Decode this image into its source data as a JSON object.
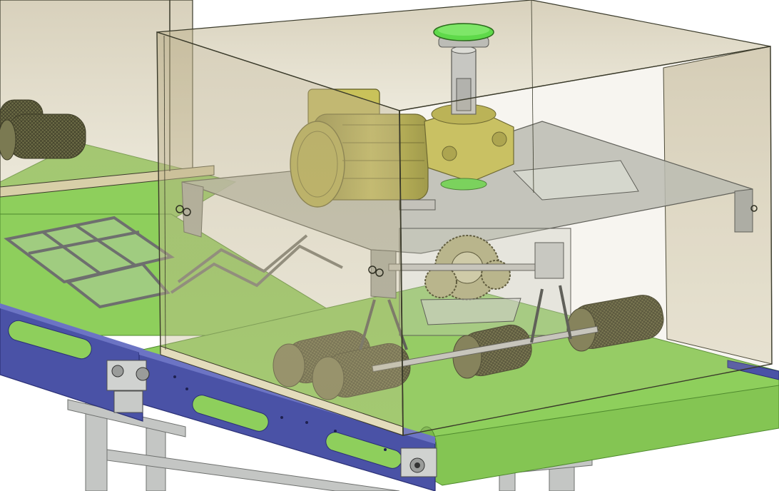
{
  "scene": {
    "subject": "conveyor-brush-station-cad-render",
    "view": "isometric",
    "colors": {
      "background": "#ffffff",
      "belt": "#8ecf5c",
      "belt_dark": "#5f9e3a",
      "rail": "#4a52a6",
      "rail_dark": "#2f3580",
      "guard_glass": "#c8b98a",
      "guard_edge": "#3a3a2a",
      "motor": "#b9b24c",
      "motor_dark": "#7d7830",
      "plate": "#b9bcb6",
      "brush": "#6b6a45",
      "brush_dark": "#4a4930",
      "knob": "#5fd94a",
      "frame": "#b8bab8",
      "shaft": "#c7c7c2",
      "gear": "#b7b48a"
    }
  }
}
